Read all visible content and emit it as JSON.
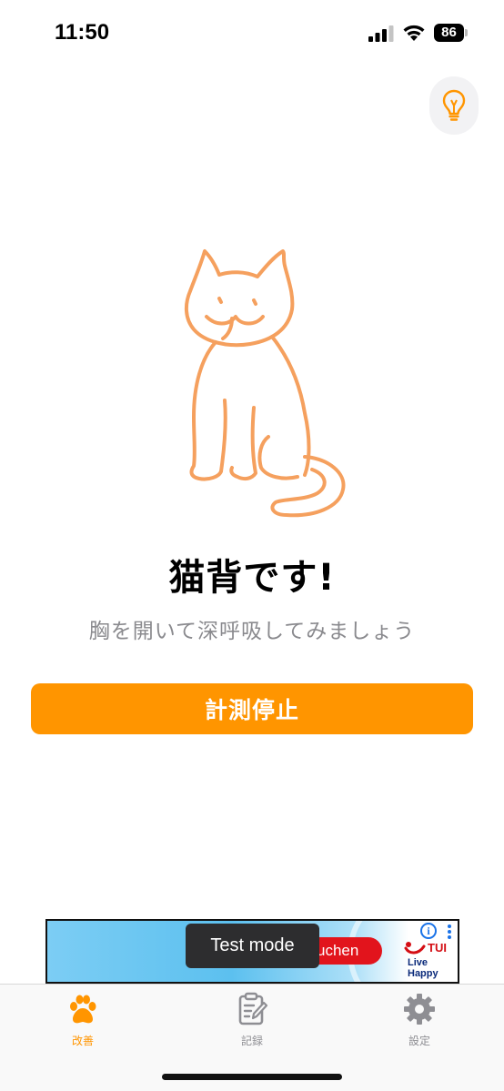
{
  "status_bar": {
    "time": "11:50",
    "battery": "86"
  },
  "tip_button": {
    "icon": "lightbulb-icon"
  },
  "illustration": {
    "icon": "cat-icon",
    "stroke_color": "#f5a05e"
  },
  "result": {
    "title": "猫背です!",
    "subtitle": "胸を開いて深呼吸してみましょう"
  },
  "stop_button": {
    "label": "計測停止",
    "color": "#ff9500"
  },
  "ad": {
    "cta": "uchen",
    "brand": "TUI",
    "tagline": "Live Happy",
    "info_icon": "i"
  },
  "toast": {
    "text": "Test mode"
  },
  "tabs": [
    {
      "label": "改善",
      "icon": "paw-icon",
      "active": true
    },
    {
      "label": "記録",
      "icon": "clipboard-edit-icon",
      "active": false
    },
    {
      "label": "設定",
      "icon": "gear-icon",
      "active": false
    }
  ],
  "colors": {
    "accent": "#ff9500",
    "inactive": "#8e8e93"
  }
}
